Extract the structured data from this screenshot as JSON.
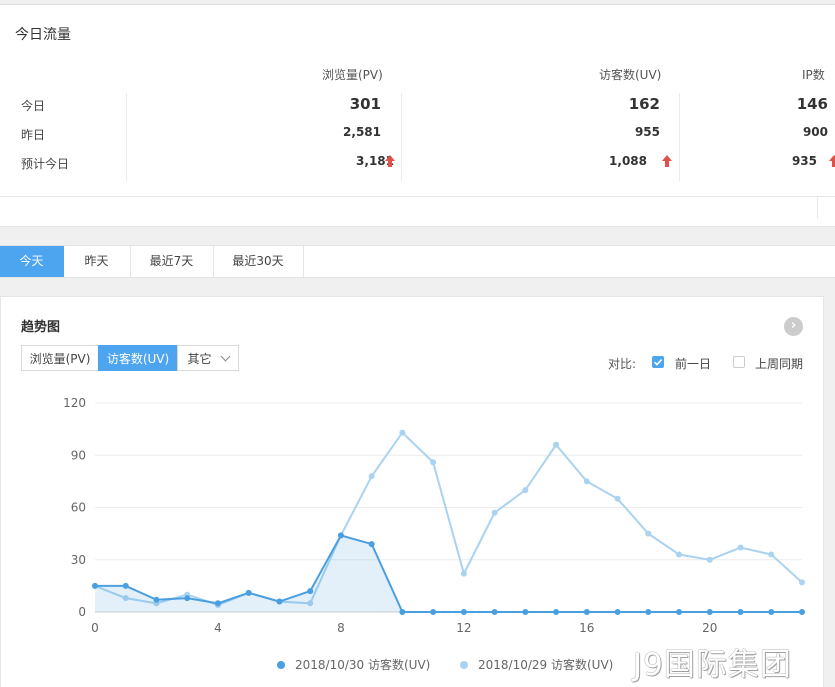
{
  "traffic": {
    "title": "今日流量",
    "headers": [
      "浏览量(PV)",
      "访客数(UV)",
      "IP数"
    ],
    "rows": [
      {
        "label": "今日",
        "pv": "301",
        "uv": "162",
        "ip": "146"
      },
      {
        "label": "昨日",
        "pv": "2,581",
        "uv": "955",
        "ip": "900"
      },
      {
        "label": "预计今日",
        "pv": "3,181",
        "uv": "1,088",
        "ip": "935"
      }
    ],
    "arrow_color": "#e0514a"
  },
  "range_tabs": [
    "今天",
    "昨天",
    "最近7天",
    "最近30天"
  ],
  "trend": {
    "title": "趋势图",
    "metric_tabs": [
      "浏览量(PV)",
      "访客数(UV)",
      "其它"
    ],
    "compare_label": "对比:",
    "compare_options": [
      {
        "label": "前一日",
        "checked": true
      },
      {
        "label": "上周同期",
        "checked": false
      }
    ]
  },
  "colors": {
    "accent": "#4ea5ef",
    "series_today": "#4a9fe0",
    "series_yesterday": "#a9d3f0"
  },
  "chart_data": {
    "type": "line",
    "x": [
      0,
      1,
      2,
      3,
      4,
      5,
      6,
      7,
      8,
      9,
      10,
      11,
      12,
      13,
      14,
      15,
      16,
      17,
      18,
      19,
      20,
      21,
      22,
      23
    ],
    "x_ticks": [
      0,
      4,
      8,
      12,
      16,
      20
    ],
    "ylim": [
      0,
      120
    ],
    "y_ticks": [
      0,
      30,
      60,
      90,
      120
    ],
    "grid": true,
    "legend_position": "bottom",
    "series": [
      {
        "name": "2018/10/30 访客数(UV)",
        "area": true,
        "values": [
          15,
          15,
          7,
          8,
          5,
          11,
          6,
          12,
          44,
          39,
          0,
          0,
          0,
          0,
          0,
          0,
          0,
          0,
          0,
          0,
          0,
          0,
          0,
          0
        ]
      },
      {
        "name": "2018/10/29 访客数(UV)",
        "area": false,
        "values": [
          15,
          8,
          5,
          10,
          4,
          11,
          6,
          5,
          44,
          78,
          103,
          86,
          22,
          57,
          70,
          96,
          75,
          65,
          45,
          33,
          30,
          37,
          33,
          17
        ]
      }
    ]
  },
  "watermark": "J9国际集团"
}
